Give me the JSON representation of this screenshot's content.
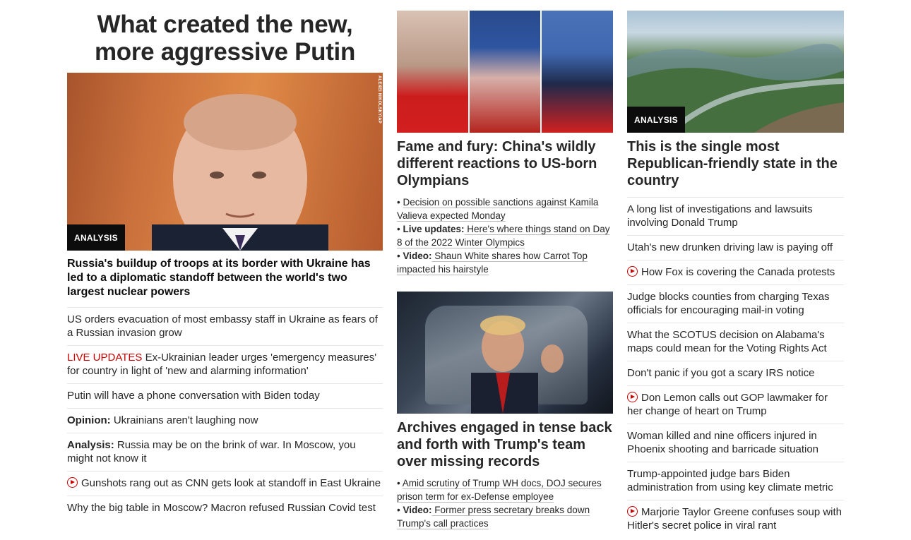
{
  "left": {
    "big_title": "What created the new, more aggressive Putin",
    "badge": "ANALYSIS",
    "photo_credit": "ALEXEI NIKOLSKY/AP",
    "lead_headline": "Russia's buildup of troops at its border with Ukraine has led to a diplomatic standoff between the world's two largest nuclear powers",
    "items": [
      {
        "prefix": "",
        "text": "US orders evacuation of most embassy staff in Ukraine as fears of a Russian invasion grow"
      },
      {
        "prefix": "LIVE UPDATES",
        "text": " Ex-Ukrainian leader urges 'emergency measures' for country in light of 'new and alarming information'"
      },
      {
        "prefix": "",
        "text": "Putin will have a phone conversation with Biden today"
      },
      {
        "prefix": "Opinion:",
        "text": " Ukrainians aren't laughing now"
      },
      {
        "prefix": "Analysis:",
        "text": " Russia may be on the brink of war. In Moscow, you might not know it"
      },
      {
        "prefix": "",
        "text": "Gunshots rang out as CNN gets look at standoff in East Ukraine"
      },
      {
        "prefix": "",
        "text": "Why the big table in Moscow? Macron refused Russian Covid test"
      }
    ]
  },
  "middle": {
    "story1": {
      "title": "Fame and fury: China's wildly different reactions to US-born Olympians",
      "bullets": [
        {
          "label": "",
          "text": "Decision on possible sanctions against Kamila Valieva expected Monday"
        },
        {
          "label": "Live updates:",
          "text": " Here's where things stand on Day 8 of the 2022 Winter Olympics"
        },
        {
          "label": "Video:",
          "text": " Shaun White shares how Carrot Top impacted his hairstyle"
        }
      ]
    },
    "story2": {
      "title": "Archives engaged in tense back and forth with Trump's team over missing records",
      "bullets": [
        {
          "label": "",
          "text": "Amid scrutiny of Trump WH docs, DOJ secures prison term for ex-Defense employee"
        },
        {
          "label": "Video:",
          "text": " Former press secretary breaks down Trump's call practices"
        }
      ]
    }
  },
  "right": {
    "badge": "ANALYSIS",
    "title": "This is the single most Republican-friendly state in the country",
    "items": [
      "A long list of investigations and lawsuits involving Donald Trump",
      "Utah's new drunken driving law is paying off",
      "How Fox is covering the Canada protests",
      "Judge blocks counties from charging Texas officials for encouraging mail-in voting",
      "What the SCOTUS decision on Alabama's maps could mean for the Voting Rights Act",
      "Don't panic if you got a scary IRS notice",
      "Don Lemon calls out GOP lawmaker for her change of heart on Trump",
      "Woman killed and nine officers injured in Phoenix shooting and barricade situation",
      "Trump-appointed judge bars Biden administration from using key climate metric",
      "Marjorie Taylor Greene confuses soup with Hitler's secret police in viral rant"
    ]
  }
}
